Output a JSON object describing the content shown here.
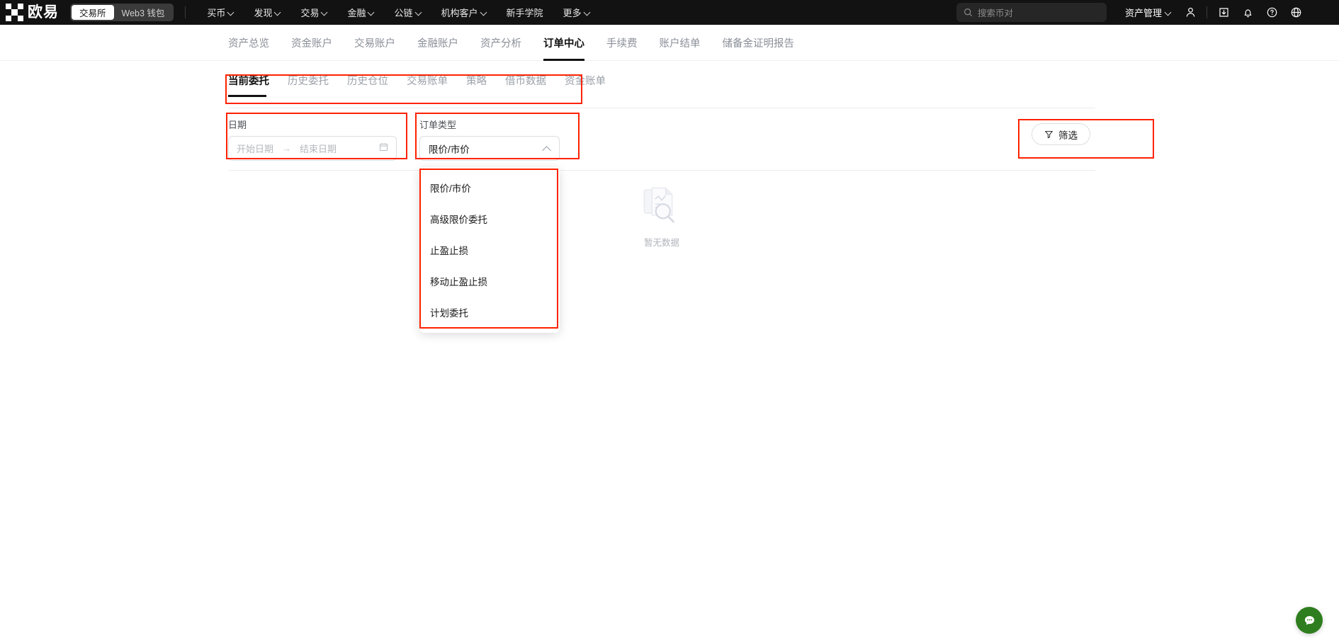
{
  "header": {
    "brand_name": "欧易",
    "segments": [
      {
        "label": "交易所",
        "active": true
      },
      {
        "label": "Web3 钱包",
        "active": false
      }
    ],
    "nav": [
      {
        "label": "买币",
        "caret": true
      },
      {
        "label": "发现",
        "caret": true
      },
      {
        "label": "交易",
        "caret": true
      },
      {
        "label": "金融",
        "caret": true
      },
      {
        "label": "公链",
        "caret": true
      },
      {
        "label": "机构客户",
        "caret": true
      },
      {
        "label": "新手学院",
        "caret": false
      },
      {
        "label": "更多",
        "caret": true
      }
    ],
    "search": {
      "placeholder": "搜索币对",
      "icon": "search-icon"
    },
    "asset_management": {
      "label": "资产管理",
      "caret": true
    },
    "icons": [
      "user-icon",
      "download-icon",
      "bell-icon",
      "help-icon",
      "globe-icon"
    ]
  },
  "subnav": {
    "items": [
      {
        "label": "资产总览",
        "active": false
      },
      {
        "label": "资金账户",
        "active": false
      },
      {
        "label": "交易账户",
        "active": false
      },
      {
        "label": "金融账户",
        "active": false
      },
      {
        "label": "资产分析",
        "active": false
      },
      {
        "label": "订单中心",
        "active": true
      },
      {
        "label": "手续费",
        "active": false
      },
      {
        "label": "账户结单",
        "active": false
      },
      {
        "label": "储备金证明报告",
        "active": false
      }
    ]
  },
  "tabs": [
    {
      "label": "当前委托",
      "active": true
    },
    {
      "label": "历史委托",
      "active": false
    },
    {
      "label": "历史仓位",
      "active": false
    },
    {
      "label": "交易账单",
      "active": false
    },
    {
      "label": "策略",
      "active": false
    },
    {
      "label": "借币数据",
      "active": false
    },
    {
      "label": "资金账单",
      "active": false
    }
  ],
  "filters": {
    "date": {
      "label": "日期",
      "start_placeholder": "开始日期",
      "end_placeholder": "结束日期",
      "range_arrow": "→",
      "calendar_icon": "calendar-icon"
    },
    "order_type": {
      "label": "订单类型",
      "selected": "限价/市价",
      "expanded": true,
      "options": [
        "限价/市价",
        "高级限价委托",
        "止盈止损",
        "移动止盈止损",
        "计划委托"
      ]
    },
    "filter_button": {
      "label": "筛选",
      "icon": "funnel-icon"
    }
  },
  "empty_state": {
    "text": "暂无数据",
    "icon": "no-data-document-search-icon"
  },
  "chat_fab": {
    "icon": "chat-bubble-icon"
  },
  "colors": {
    "accent_red": "#ff2200",
    "header_bg": "#121212",
    "fab_green": "#2e7d1e",
    "active_text": "#121212",
    "muted_text": "#9aa0a8"
  }
}
